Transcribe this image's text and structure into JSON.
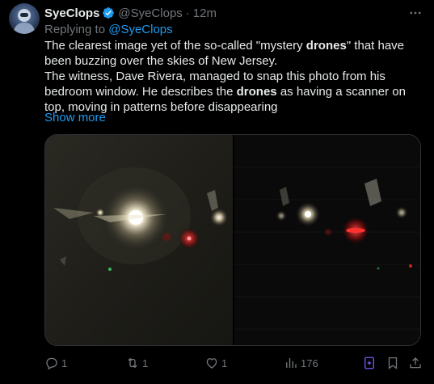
{
  "author": {
    "name": "SyeClops",
    "handle": "@SyeClops",
    "separator": "·",
    "time": "12m"
  },
  "reply": {
    "prefix": "Replying to",
    "target": "@SyeClops"
  },
  "body": {
    "p1_a": "The clearest image yet of the so-called \"mystery ",
    "p1_bold": "drones",
    "p1_b": "\" that have been buzzing over the skies of New Jersey.",
    "p2_a": "The witness, Dave Rivera, managed to snap this photo from his bedroom window. He describes the ",
    "p2_bold": "drones",
    "p2_b": " as having a scanner on top, moving in patterns before disappearing",
    "show_more": "Show more"
  },
  "actions": {
    "replies": "1",
    "reposts": "1",
    "likes": "1",
    "views": "176"
  },
  "icons": {
    "verified": "verified-badge-icon",
    "more": "more-options-icon",
    "reply": "reply-icon",
    "repost": "repost-icon",
    "like": "heart-icon",
    "views": "views-chart-icon",
    "grok": "grok-icon",
    "bookmark": "bookmark-icon",
    "share": "share-icon"
  },
  "colors": {
    "background": "#000000",
    "text": "#e7e9ea",
    "muted": "#71767b",
    "accent": "#1d9bf0",
    "grok_accent": "#7856ff"
  }
}
